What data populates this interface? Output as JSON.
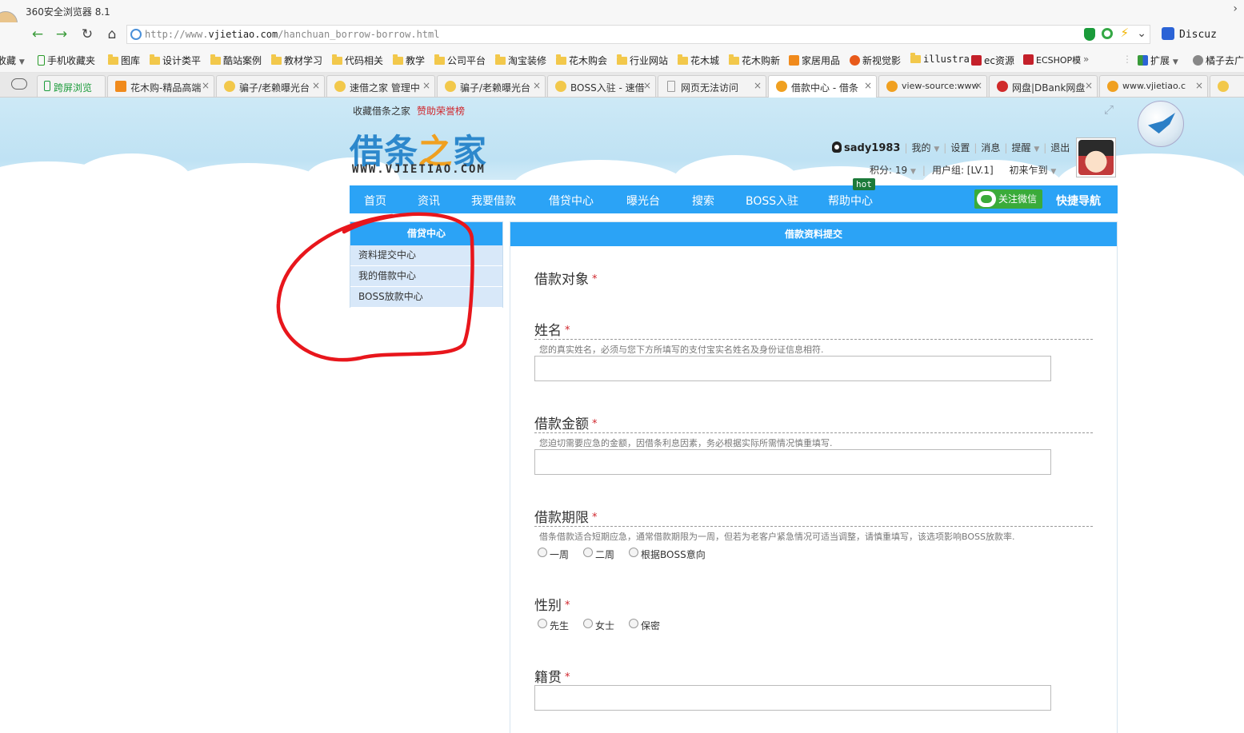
{
  "browser": {
    "title": "360安全浏览器 8.1",
    "url_prefix": "http://www.",
    "url_domain": "vjietiao.com",
    "url_path": "/hanchuan_borrow-borrow.html",
    "search_engine": "Discuz"
  },
  "bookmarks": [
    "收藏",
    "手机收藏夹",
    "图库",
    "设计类平",
    "酷站案例",
    "教材学习",
    "代码相关",
    "教学",
    "公司平台",
    "淘宝装修",
    "花木购会",
    "行业网站",
    "花木城",
    "花木购新",
    "家居用品",
    "新视觉影",
    "illustra",
    "ec资源",
    "ECSHOP模",
    "扩展",
    "橘子去广"
  ],
  "tabs": [
    "跨屏浏览",
    "花木购-精品高端",
    "骗子/老赖曝光台",
    "速借之家 管理中",
    "骗子/老赖曝光台",
    "BOSS入驻 - 速借",
    "网页无法访问",
    "借款中心 - 借条",
    "view-source:www",
    "网盘|DBank网盘",
    "www.vjietiao.c"
  ],
  "site": {
    "toplinks": {
      "fav": "收藏借条之家",
      "sponsor": "赞助荣誉榜"
    },
    "logo_cn_1": "借条",
    "logo_cn_2": "之",
    "logo_cn_3": "家",
    "logo_en": "WWW.VJIETIAO.COM",
    "user": {
      "name": "sady1983",
      "mine": "我的",
      "settings": "设置",
      "messages": "消息",
      "remind": "提醒",
      "logout": "退出",
      "points": "积分: 19",
      "group": "用户组: [LV.1]",
      "rank": "初来乍到"
    },
    "nav": [
      "首页",
      "资讯",
      "我要借款",
      "借贷中心",
      "曝光台",
      "搜索",
      "BOSS入驻",
      "帮助中心"
    ],
    "hot": "hot",
    "wechat": "关注微信",
    "quicknav": "快捷导航"
  },
  "sidebar": {
    "title": "借贷中心",
    "items": [
      "资料提交中心",
      "我的借款中心",
      "BOSS放款中心"
    ]
  },
  "form": {
    "title": "借款资料提交",
    "req": "*",
    "target_label": "借款对象",
    "name_label": "姓名",
    "name_hint": "您的真实姓名，必须与您下方所填写的支付宝实名姓名及身份证信息相符.",
    "amount_label": "借款金额",
    "amount_hint": "您迫切需要应急的金额，因借条利息因素，务必根据实际所需情况慎重填写.",
    "term_label": "借款期限",
    "term_hint": "借条借款适合短期应急，通常借款期限为一周，但若为老客户紧急情况可适当调整，请慎重填写，该选项影响BOSS放款率.",
    "term_options": [
      "一周",
      "二周",
      "根据BOSS意向"
    ],
    "gender_label": "性别",
    "gender_options": [
      "先生",
      "女士",
      "保密"
    ],
    "native_label": "籍贯"
  }
}
